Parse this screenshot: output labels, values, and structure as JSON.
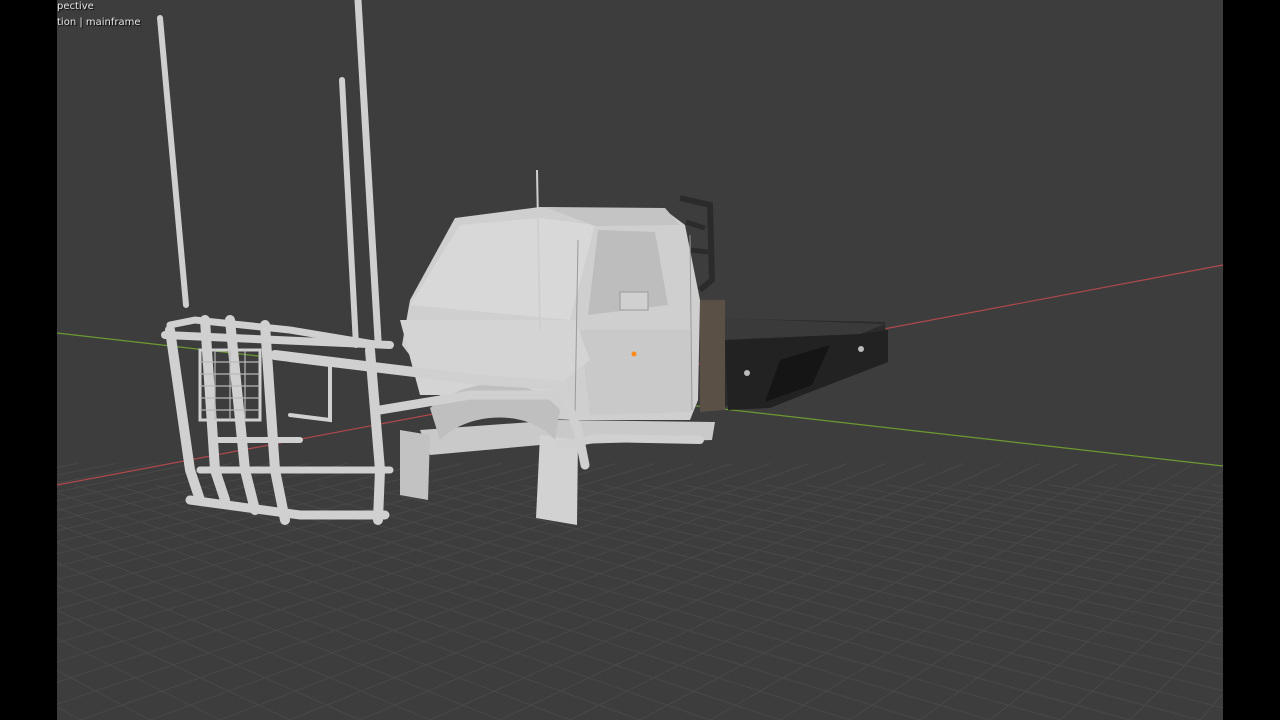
{
  "viewport": {
    "view_label": "pective",
    "collection_label": "tion | mainframe",
    "background_color": "#3d3d3d",
    "grid_color": "#484848",
    "x_axis_color": "#b0484c",
    "y_axis_color": "#6c9a30"
  },
  "model": {
    "body_color": "#cfcfcf",
    "tray_color": "#2b2b2b",
    "headboard_color": "#5a5046",
    "origin_color": "#ff8a1a"
  }
}
